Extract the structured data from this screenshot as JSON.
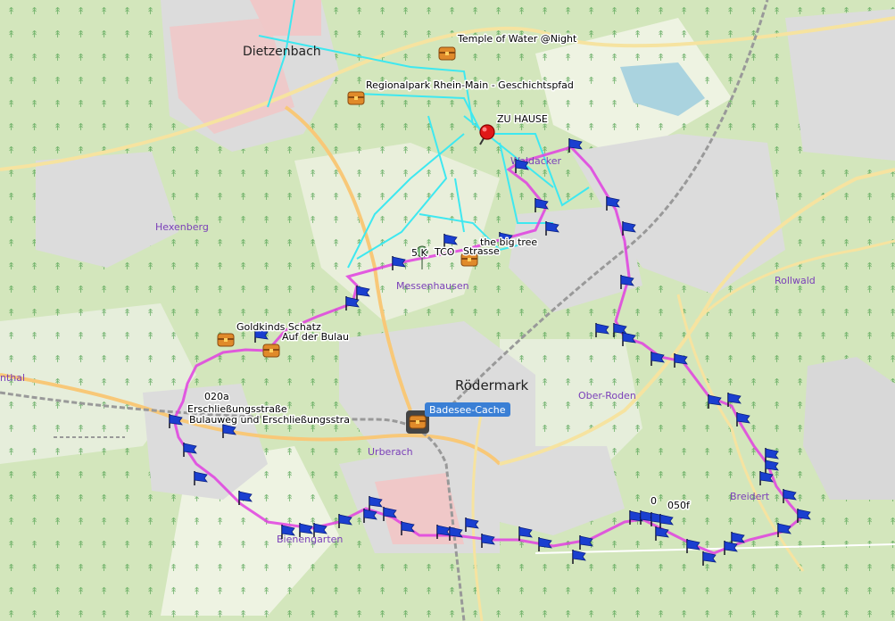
{
  "places": {
    "dietzenbach": "Dietzenbach",
    "rodermark": "Rödermark",
    "messenhausen": "Messenhausen",
    "urberach": "Urberach",
    "ober_roden": "Ober-Roden",
    "breidert": "Breidert",
    "hexenberg": "Hexenberg",
    "rollwald": "Rollwald",
    "waldacker": "Waldacker",
    "bieberngarten": "Bienengarten",
    "enthal": "nthal"
  },
  "cache_labels": {
    "temple": "Temple of Water @Night",
    "regionalpark": "Regionalpark Rhein-Main - Geschichtspfad",
    "zuhause": "ZU HAUSE",
    "big_tree": "the big tree",
    "five_k": "5 K",
    "tco": "TCO",
    "strasse": "Strasse",
    "goldkinds": "Goldkinds Schatz",
    "bulau": "Auf der Bulau",
    "o20a": "020a",
    "erschliessung": "Erschließungsstraße",
    "bulauweg": "Bulauweg und Erschließungsstra",
    "badesee": "Badesee-Cache",
    "o050f": "050f",
    "zero": "0"
  },
  "colors": {
    "route": "#e040e0",
    "track": "#3ee8f0",
    "flag": "#1a3fd0",
    "cache": "#d07020",
    "forest": "#c8dfb0",
    "urban": "#dcdcdc",
    "residential_pink": "#f0c8c8",
    "road_major": "#f8d080",
    "railway": "#999999"
  }
}
